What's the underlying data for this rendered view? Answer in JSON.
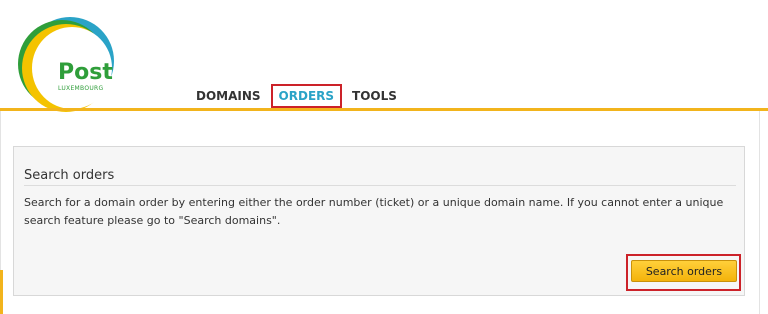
{
  "logo": {
    "brand": "Post",
    "subtitle": "LUXEMBOURG"
  },
  "nav": {
    "items": [
      {
        "label": "DOMAINS",
        "active": false
      },
      {
        "label": "ORDERS",
        "active": true
      },
      {
        "label": "TOOLS",
        "active": false
      }
    ]
  },
  "colors": {
    "accent": "#f2b41c",
    "brand_green": "#2f9e3a",
    "active_tab": "#2aa3c7",
    "highlight_box": "#cc2229"
  },
  "panel": {
    "title": "Search orders",
    "description": "Search for a domain order by entering either the order number (ticket) or a unique domain name. If you cannot enter a unique search feature please go to \"Search domains\".",
    "button_label": "Search orders"
  }
}
